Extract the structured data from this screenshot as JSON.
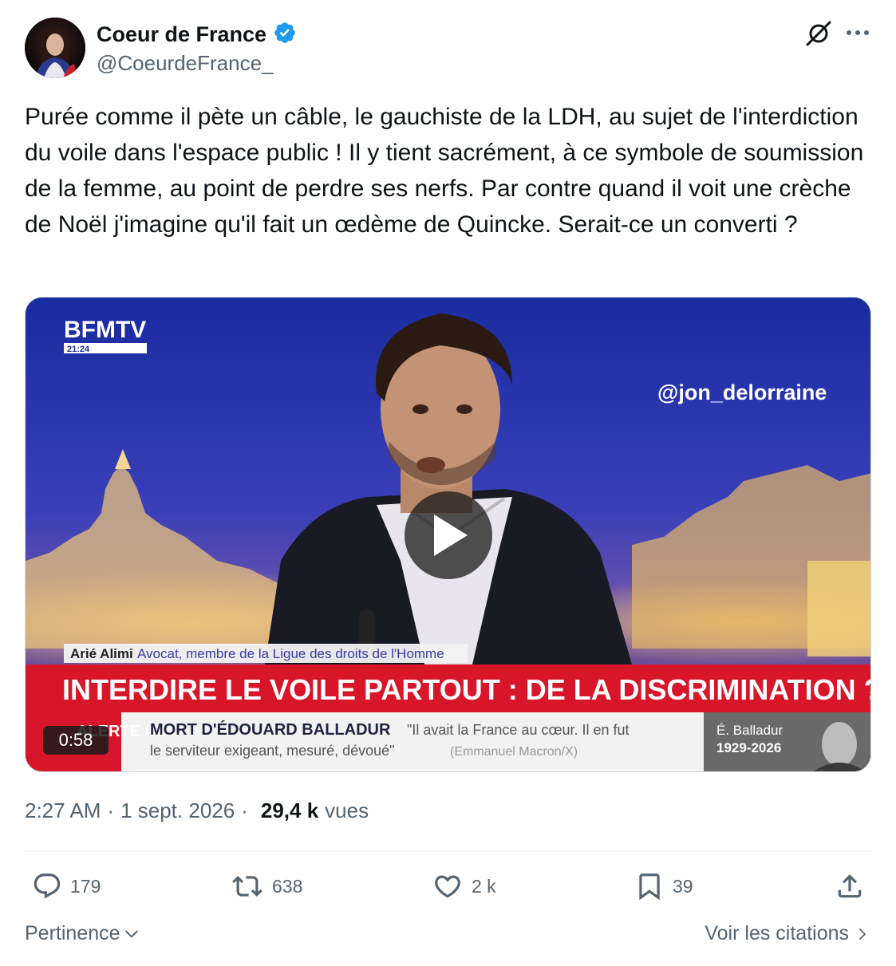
{
  "author": {
    "name": "Coeur de France",
    "handle": "@CoeurdeFrance_",
    "verified": true
  },
  "tweet": {
    "text": "Purée comme il pète un câble, le gauchiste de la LDH, au sujet de l'interdiction du voile dans l'espace public ! Il y tient sacrément, à ce symbole de soumission de la femme, au point de perdre ses nerfs. Par contre quand il voit une crèche de Noël j'imagine qu'il fait un œdème de Quincke. Serait-ce un converti ?"
  },
  "video": {
    "channel_logo": "BFMTV",
    "channel_time": "21:24",
    "watermark": "@jon_delorraine",
    "caption_name": "Arié Alimi",
    "caption_role": "Avocat, membre de la Ligue des droits de l'Homme",
    "headline": "INTERDIRE LE VOILE PARTOUT : DE LA DISCRIMINATION ?",
    "ticker_label": "ALERTE INFO",
    "ticker_title": "MORT D'ÉDOUARD BALLADUR",
    "ticker_quote_1": "\"Il avait la France au cœur. Il en fut",
    "ticker_quote_2": "le serviteur exigeant, mesuré, dévoué\"",
    "ticker_source": "(Emmanuel Macron/X)",
    "portrait_name": "É. Balladur",
    "portrait_years": "1929-2026",
    "duration": "0:58"
  },
  "meta": {
    "time": "2:27 AM",
    "separator": "·",
    "date": "1 sept. 2026",
    "views_count": "29,4 k",
    "views_label": "vues"
  },
  "actions": {
    "replies": "179",
    "reposts": "638",
    "likes": "2 k",
    "bookmarks": "39"
  },
  "footer": {
    "sort_label": "Pertinence",
    "quotes_link": "Voir les citations"
  },
  "colors": {
    "verified": "#1d9bf0",
    "secondary_text": "#536471",
    "headline_band": "#d8162a"
  }
}
